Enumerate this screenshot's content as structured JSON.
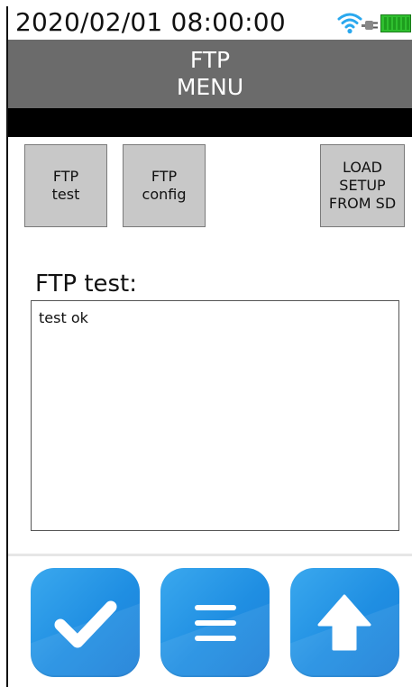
{
  "status_bar": {
    "datetime": "2020/02/01 08:00:00",
    "wifi_icon": "wifi-icon",
    "power_icon": "plug-icon",
    "battery_icon": "battery-icon",
    "battery_level_fraction": 1.0
  },
  "header": {
    "title_line1": "FTP",
    "title_line2": "MENU"
  },
  "buttons": {
    "ftp_test": {
      "line1": "FTP",
      "line2": "test"
    },
    "ftp_config": {
      "line1": "FTP",
      "line2": "config"
    },
    "load_setup": {
      "line1": "LOAD",
      "line2": "SETUP",
      "line3": "FROM SD"
    }
  },
  "section": {
    "label": "FTP test:"
  },
  "log": {
    "content": "test ok"
  },
  "bottom_actions": [
    {
      "icon": "checkmark-icon"
    },
    {
      "icon": "menu-icon"
    },
    {
      "icon": "arrow-up-icon"
    }
  ],
  "colors": {
    "header_bg": "#6b6b6b",
    "band_bg": "#000000",
    "button_bg": "#c8c8c8",
    "action_blue": "#1f8ee2",
    "battery_green": "#2fbf2f"
  }
}
